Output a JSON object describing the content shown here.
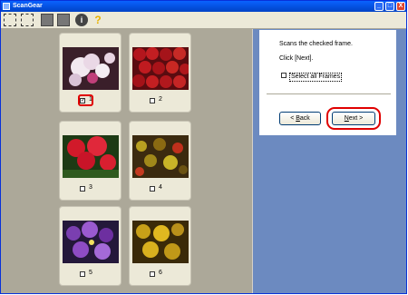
{
  "window": {
    "title": "ScanGear",
    "min_label": "_",
    "max_label": "□",
    "close_label": "X"
  },
  "toolbar": {
    "items": [
      {
        "name": "crop-icon"
      },
      {
        "name": "crop-clear-icon"
      },
      {
        "name": "rotate-left-icon"
      },
      {
        "name": "rotate-right-icon"
      },
      {
        "name": "info-icon",
        "glyph": "i"
      },
      {
        "name": "help-icon",
        "glyph": "?"
      }
    ]
  },
  "frames": [
    {
      "label": "1",
      "checked": true,
      "check_glyph": "✓",
      "image": "white orchid flowers"
    },
    {
      "label": "2",
      "checked": false,
      "check_glyph": "",
      "image": "red apples"
    },
    {
      "label": "3",
      "checked": false,
      "check_glyph": "",
      "image": "red geraniums"
    },
    {
      "label": "4",
      "checked": false,
      "check_glyph": "",
      "image": "yellow-red foliage"
    },
    {
      "label": "5",
      "checked": false,
      "check_glyph": "",
      "image": "purple flowers"
    },
    {
      "label": "6",
      "checked": false,
      "check_glyph": "",
      "image": "yellow flowers"
    }
  ],
  "panel": {
    "instruction": "Scans the checked frame.",
    "click_next": "Click [Next].",
    "select_all": "Select all Frames",
    "back_prefix": "< ",
    "back_key": "B",
    "back_rest": "ack",
    "next_key": "N",
    "next_rest": "ext >"
  },
  "colors": {
    "highlight": "#e00000",
    "accent": "#0a62ff"
  }
}
